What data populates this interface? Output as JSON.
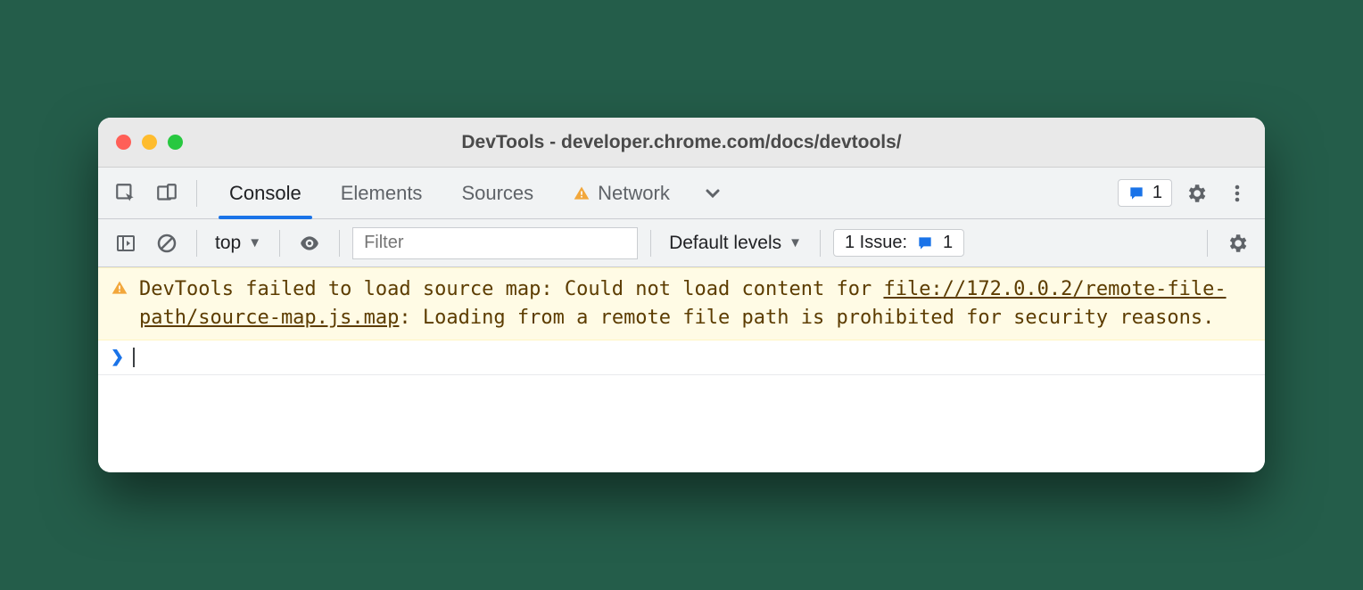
{
  "window": {
    "title": "DevTools - developer.chrome.com/docs/devtools/"
  },
  "tabs": {
    "console": "Console",
    "elements": "Elements",
    "sources": "Sources",
    "network": "Network"
  },
  "badge": {
    "count": "1"
  },
  "console_toolbar": {
    "context": "top",
    "filter_placeholder": "Filter",
    "levels": "Default levels",
    "issues_label": "1 Issue:",
    "issues_count": "1"
  },
  "message": {
    "pre": "DevTools failed to load source map: Could not load content for ",
    "link": "file://172.0.0.2/remote-file-path/source-map.js.map",
    "post": ": Loading from a remote file path is prohibited for security reasons."
  }
}
